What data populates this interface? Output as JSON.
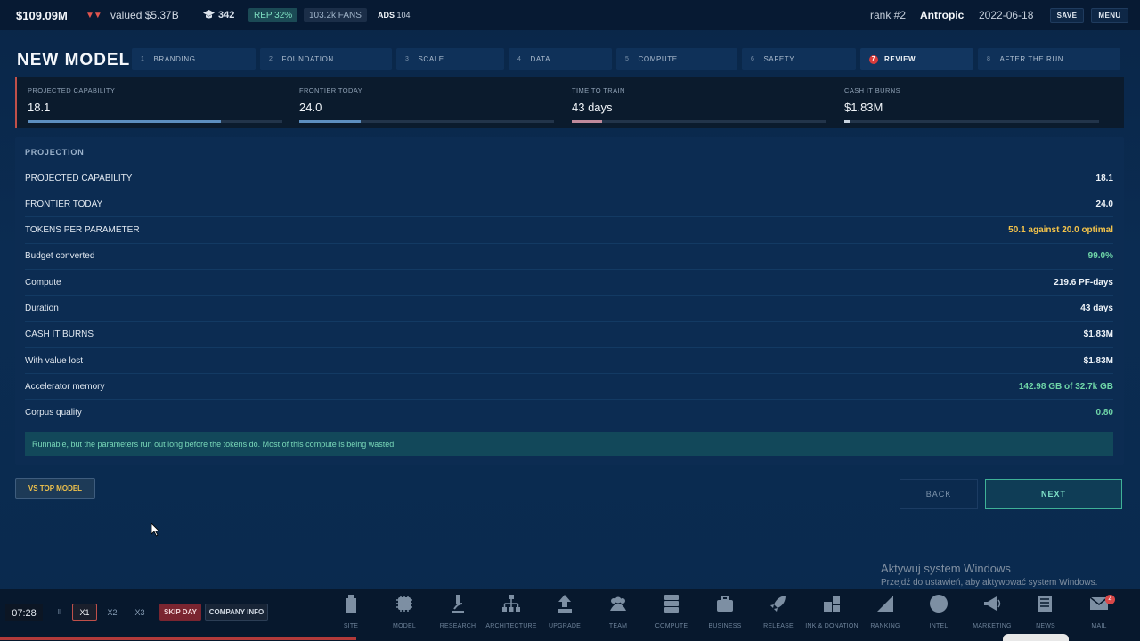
{
  "topbar": {
    "cash": "$109.09M",
    "trend_arrows": "▼▼",
    "valued": "valued $5.37B",
    "research_points": "342",
    "rep": "REP 32%",
    "fans": "103.2k FANS",
    "ads_label": "ADS",
    "ads_value": "104",
    "rank": "rank #2",
    "company": "Antropic",
    "date": "2022-06-18",
    "save_label": "SAVE",
    "menu_label": "MENU"
  },
  "page": {
    "title": "NEW MODEL"
  },
  "steps": [
    {
      "num": "1",
      "label": "BRANDING"
    },
    {
      "num": "2",
      "label": "FOUNDATION"
    },
    {
      "num": "3",
      "label": "SCALE"
    },
    {
      "num": "4",
      "label": "DATA"
    },
    {
      "num": "5",
      "label": "COMPUTE"
    },
    {
      "num": "6",
      "label": "SAFETY"
    },
    {
      "num": "7",
      "label": "REVIEW"
    },
    {
      "num": "8",
      "label": "AFTER THE RUN"
    }
  ],
  "kpis": [
    {
      "label": "PROJECTED CAPABILITY",
      "value": "18.1",
      "fill": 0.76
    },
    {
      "label": "FRONTIER TODAY",
      "value": "24.0",
      "fill": 0.24
    },
    {
      "label": "TIME TO TRAIN",
      "value": "43 days",
      "fill": 0.12
    },
    {
      "label": "CASH IT BURNS",
      "value": "$1.83M",
      "fill": 0.02
    }
  ],
  "projection": {
    "heading": "PROJECTION",
    "rows": [
      {
        "key": "PROJECTED CAPABILITY",
        "value": "18.1",
        "color": "#eef3f8"
      },
      {
        "key": "FRONTIER TODAY",
        "value": "24.0",
        "color": "#eef3f8"
      },
      {
        "key": "TOKENS PER PARAMETER",
        "value": "50.1 against 20.0 optimal",
        "color": "#f2c24a"
      },
      {
        "key": "Budget converted",
        "value": "99.0%",
        "color": "#6fd6a8"
      },
      {
        "key": "Compute",
        "value": "219.6 PF-days",
        "color": "#eef3f8"
      },
      {
        "key": "Duration",
        "value": "43 days",
        "color": "#eef3f8"
      },
      {
        "key": "CASH IT BURNS",
        "value": "$1.83M",
        "color": "#eef3f8"
      },
      {
        "key": "With value lost",
        "value": "$1.83M",
        "color": "#eef3f8"
      },
      {
        "key": "Accelerator memory",
        "value": "142.98 GB of 32.7k GB",
        "color": "#6fd6a8"
      },
      {
        "key": "Corpus quality",
        "value": "0.80",
        "color": "#6fd6a8"
      }
    ],
    "notice": "Runnable, but the parameters run out long before the tokens do. Most of this compute is being wasted."
  },
  "actions": {
    "vs_top": "VS TOP MODEL",
    "back": "BACK",
    "next": "NEXT"
  },
  "watermark": {
    "line1": "Aktywuj system Windows",
    "line2": "Przejdź do ustawień, aby aktywować system Windows."
  },
  "bottombar": {
    "time": "07:28",
    "pause": "II",
    "x1": "X1",
    "x2": "X2",
    "x3": "X3",
    "skip_day": "SKIP DAY",
    "company_info": "COMPANY INFO",
    "nav": [
      {
        "label": "SITE",
        "icon": "building-icon"
      },
      {
        "label": "MODEL",
        "icon": "chip-icon"
      },
      {
        "label": "RESEARCH",
        "icon": "microscope-icon"
      },
      {
        "label": "ARCHITECTURE",
        "icon": "hierarchy-icon"
      },
      {
        "label": "UPGRADE",
        "icon": "upgrade-icon"
      },
      {
        "label": "TEAM",
        "icon": "team-icon"
      },
      {
        "label": "COMPUTE",
        "icon": "server-icon"
      },
      {
        "label": "BUSINESS",
        "icon": "briefcase-icon"
      },
      {
        "label": "RELEASE",
        "icon": "rocket-icon"
      },
      {
        "label": "INK & DONATION",
        "icon": "blocks-icon"
      },
      {
        "label": "RANKING",
        "icon": "ranking-icon"
      },
      {
        "label": "INTEL",
        "icon": "globe-icon"
      },
      {
        "label": "MARKETING",
        "icon": "megaphone-icon"
      },
      {
        "label": "NEWS",
        "icon": "newspaper-icon"
      },
      {
        "label": "MAIL",
        "icon": "mail-icon",
        "badge": "4"
      }
    ]
  }
}
